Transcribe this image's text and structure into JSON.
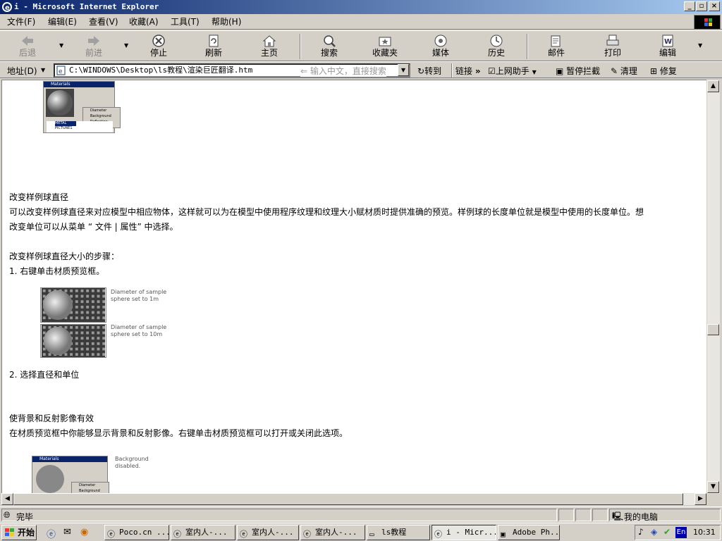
{
  "window": {
    "title": "i - Microsoft Internet Explorer"
  },
  "menu": [
    "文件(F)",
    "编辑(E)",
    "查看(V)",
    "收藏(A)",
    "工具(T)",
    "帮助(H)"
  ],
  "toolbar": {
    "back": "后退",
    "forward": "前进",
    "stop": "停止",
    "refresh": "刷新",
    "home": "主页",
    "search": "搜索",
    "favorites": "收藏夹",
    "media": "媒体",
    "history": "历史",
    "mail": "邮件",
    "print": "打印",
    "edit": "编辑"
  },
  "address": {
    "label": "地址(D)",
    "url": "C:\\WINDOWS\\Desktop\\ls教程\\渲染巨匠翻译.htm",
    "search_placeholder": "输入中文，直接搜索",
    "go": "转到",
    "links": "链接",
    "helper": "上网助手",
    "block": "暂停拦截",
    "clean": "清理",
    "repair": "修复"
  },
  "content": {
    "section1_title": "改变样例球直径",
    "section1_p1": "可以改变样例球直径来对应模型中相应物体，这样就可以为在模型中使用程序纹理和纹理大小赋材质时提供准确的预览。样例球的长度单位就是模型中使用的长度单位。想",
    "section1_p2": "改变单位可以从菜单 “ 文件 | 属性” 中选择。",
    "steps_title": "改变样例球直径大小的步骤：",
    "step1": "1. 右键单击材质预览框。",
    "step2": "2. 选择直径和单位",
    "caption1a": "Diameter of sample",
    "caption1b": "sphere set to 1m",
    "caption2a": "Diameter of sample",
    "caption2b": "sphere set to 10m",
    "section2_title": "使背景和反射影像有效",
    "section2_p1": "在材质预览框中你能够显示背景和反射影像。右键单击材质预览框可以打开或关闭此选项。",
    "caption3a": "Background",
    "caption3b": "disabled.",
    "mini_title": "Materials",
    "mini_menu": [
      "Diameter",
      "Background",
      "Reflection"
    ],
    "mini_list": [
      "METAL",
      "PICTURE1"
    ],
    "mini_menu2": [
      "Diameter",
      "Background"
    ]
  },
  "status": {
    "text": "完毕",
    "zone": "我的电脑"
  },
  "taskbar": {
    "start": "开始",
    "tasks": [
      "Poco.cn ...",
      "室内人-...",
      "室内人-...",
      "室内人-...",
      "ls教程",
      "i - Micr...",
      "Adobe Ph..."
    ],
    "active_index": 5,
    "lang": "En",
    "time": "10:31"
  }
}
